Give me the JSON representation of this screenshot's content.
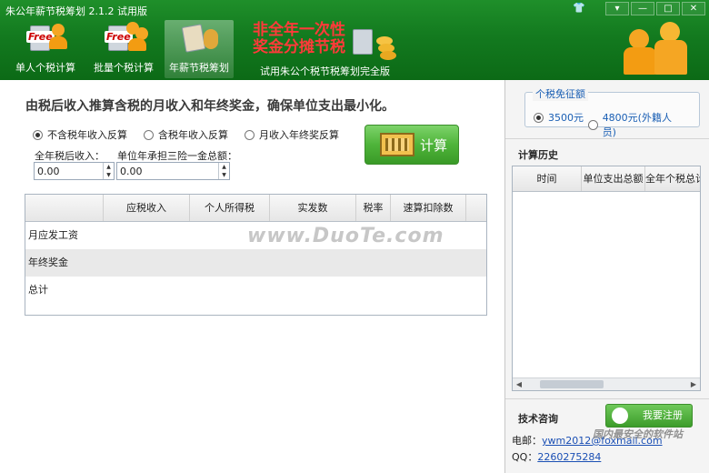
{
  "window": {
    "title": "朱公年薪节税筹划 2.1.2 试用版",
    "controls": [
      "▾",
      "—",
      "□",
      "✕"
    ]
  },
  "nav": [
    {
      "label": "单人个税计算",
      "badge": "Free"
    },
    {
      "label": "批量个税计算",
      "badge": "Free"
    },
    {
      "label": "年薪节税筹划",
      "active": true
    },
    {
      "label": "试用朱公个税节税筹划完全版"
    }
  ],
  "banner": {
    "line1": "非全年一次性",
    "line2": "奖金分摊节税"
  },
  "main": {
    "headline": "由税后收入推算含税的月收入和年终奖金，确保单位支出最小化。",
    "radio_options": [
      {
        "label": "不含税年收入反算",
        "checked": true
      },
      {
        "label": "含税年收入反算",
        "checked": false
      },
      {
        "label": "月收入年终奖反算",
        "checked": false
      }
    ],
    "field1": {
      "label": "全年税后收入：",
      "value": "0.00"
    },
    "field2": {
      "label": "单位年承担三险一金总额：",
      "value": "0.00"
    },
    "calc_button": "计算",
    "table": {
      "columns": [
        "",
        "应税收入",
        "个人所得税",
        "实发数",
        "税率",
        "速算扣除数"
      ],
      "rows": [
        "月应发工资",
        "年终奖金",
        "总计"
      ]
    },
    "watermark": "www.DuoTe.com"
  },
  "side": {
    "exemption": {
      "title": "个税免征额",
      "options": [
        {
          "label": "3500元",
          "checked": true
        },
        {
          "label": "4800元(外籍人员)",
          "checked": false
        }
      ]
    },
    "history": {
      "title": "计算历史",
      "columns": [
        "时间",
        "单位支出总额",
        "全年个税总计"
      ]
    },
    "support": {
      "title": "技术咨询",
      "email_label": "电邮：",
      "email": "ywm2012@foxmail.com",
      "qq_label": "QQ：",
      "qq": "2260275284",
      "register_button": "我要注册",
      "watermark": "国内最安全的软件站"
    }
  },
  "colors": {
    "header": "#137a1f",
    "accent_green": "#4fb43a",
    "link": "#1a4fb4",
    "banner_red": "#ff3a3a"
  }
}
